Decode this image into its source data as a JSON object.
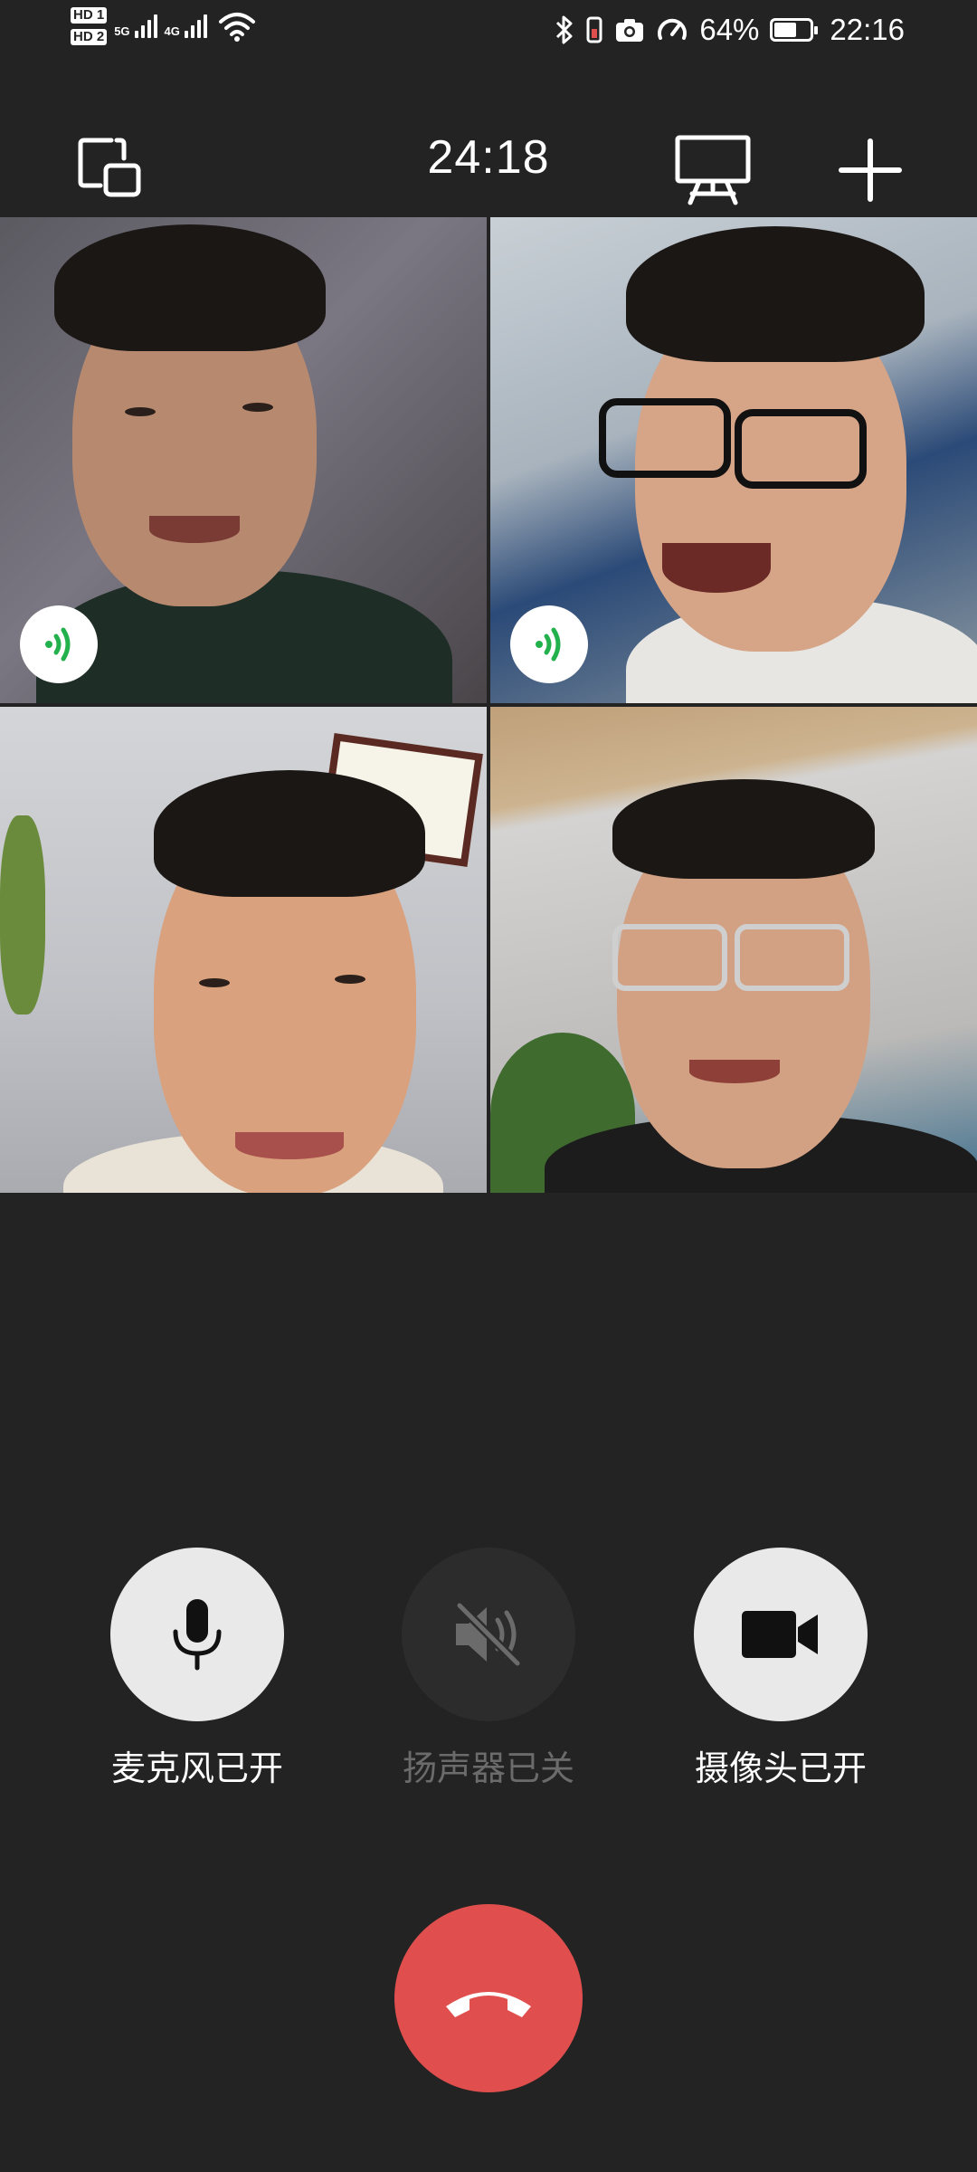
{
  "status_bar": {
    "sim1": "HD 1",
    "sim2": "HD 2",
    "net1": "5G",
    "net2": "4G",
    "battery_percent": "64%",
    "battery_level": 0.64,
    "time": "22:16",
    "icons": [
      "bluetooth-icon",
      "vibrate-icon",
      "camera-icon",
      "speed-icon",
      "wifi-icon"
    ]
  },
  "header": {
    "call_duration": "24:18",
    "left_icon": "minimize-window-icon",
    "right_icons": [
      "screen-share-icon",
      "add-participant-icon"
    ]
  },
  "participants": [
    {
      "speaking": true
    },
    {
      "speaking": true
    },
    {
      "speaking": false
    },
    {
      "speaking": false
    }
  ],
  "controls": {
    "microphone": {
      "label": "麦克风已开",
      "state": "on",
      "icon": "microphone-icon"
    },
    "speaker": {
      "label": "扬声器已关",
      "state": "off",
      "icon": "speaker-muted-icon"
    },
    "camera": {
      "label": "摄像头已开",
      "state": "on",
      "icon": "video-camera-icon"
    },
    "hangup": {
      "icon": "hang-up-icon",
      "color": "#e04e4e"
    }
  },
  "colors": {
    "background": "#232323",
    "speaking_indicator": "#22b14c",
    "control_on": "#e9e9e9",
    "control_off": "#2c2c2c"
  }
}
